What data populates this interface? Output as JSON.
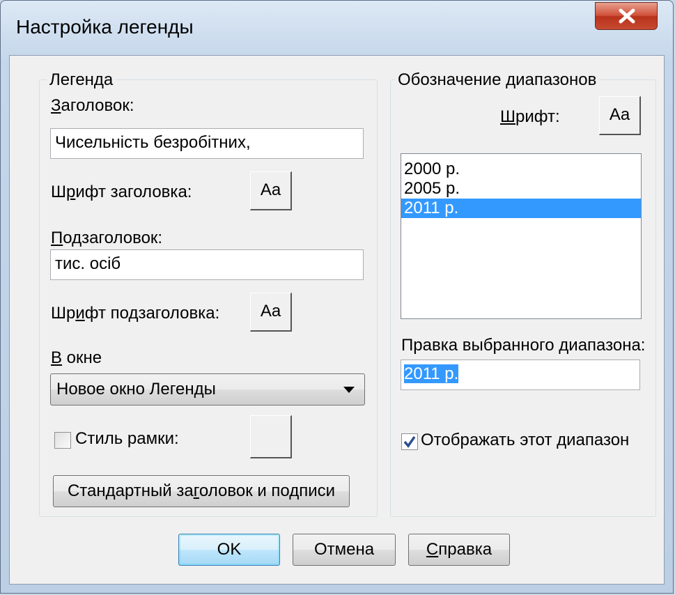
{
  "window": {
    "title": "Настройка легенды",
    "close_symbol": "X"
  },
  "legend_group": {
    "label": "Легенда",
    "title_label_hotkey": "З",
    "title_label_rest": "аголовок:",
    "title_value": "Чисельність безробітних,",
    "title_font_label_a": "Ш",
    "title_font_label_hotkey": "р",
    "title_font_label_b": "ифт заголовка:",
    "title_font_button": "Aa",
    "subtitle_label_hotkey": "П",
    "subtitle_label_rest": "одзаголовок:",
    "subtitle_value": "тис. осіб",
    "subtitle_font_label_a": "Шр",
    "subtitle_font_label_hotkey": "и",
    "subtitle_font_label_b": "фт подзаголовка:",
    "subtitle_font_button": "Aa",
    "window_label_hotkey": "В",
    "window_label_rest": " окне",
    "window_select_value": "Новое окно Легенды",
    "frame_style_label": "Стиль рамки:",
    "frame_style_checked": false,
    "standard_button_a": "Стандартный за",
    "standard_button_hotkey": "г",
    "standard_button_b": "оловок и подписи"
  },
  "ranges_group": {
    "label": "Обозначение диапазонов",
    "font_label_hotkey": "Ш",
    "font_label_rest": "рифт:",
    "font_button": "Aa",
    "items": [
      {
        "label": "2000 р.",
        "selected": false
      },
      {
        "label": "2005 р.",
        "selected": false
      },
      {
        "label": "2011 р.",
        "selected": true
      }
    ],
    "edit_label_a": "Правка выбранного ",
    "edit_label_hotkey": "д",
    "edit_label_b": "иапазона:",
    "edit_value": "2011 р.",
    "show_label": "Отображать этот диапазон",
    "show_checked": true
  },
  "footer": {
    "ok_label": "OK",
    "cancel_label": "Отмена",
    "help_hotkey": "С",
    "help_rest": "правка"
  }
}
